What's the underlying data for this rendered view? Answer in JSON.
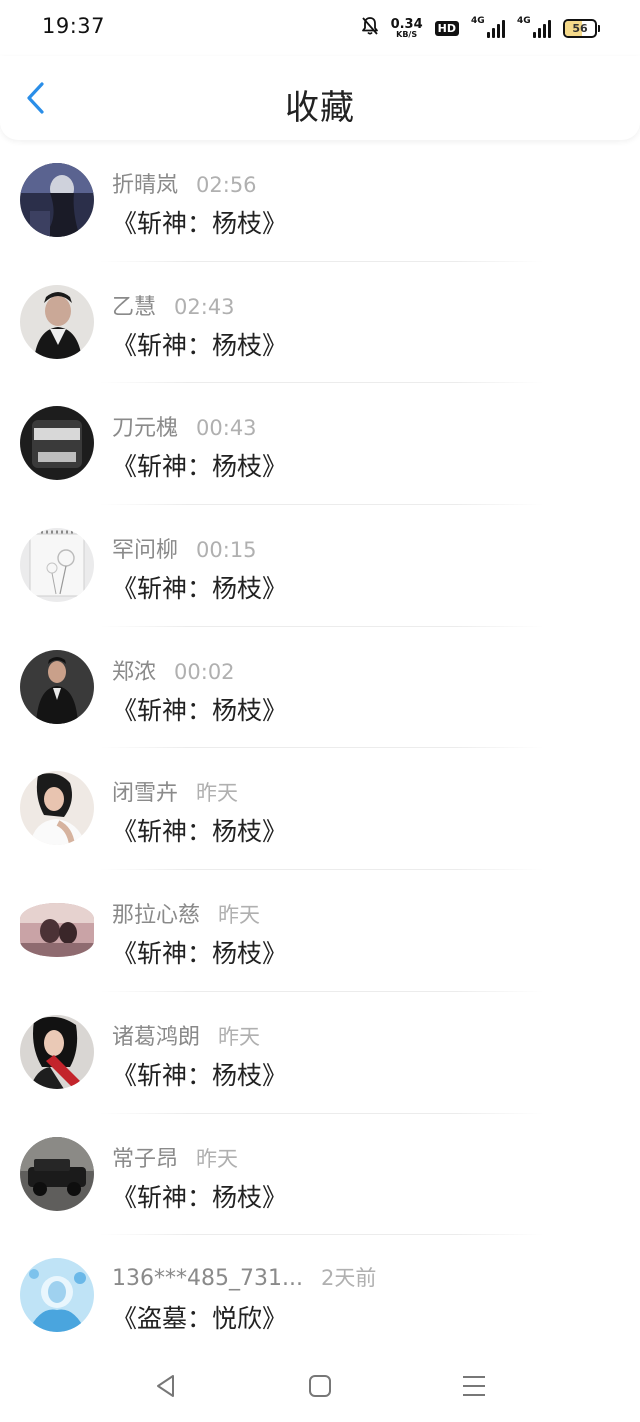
{
  "status_bar": {
    "time": "19:37",
    "net_speed_value": "0.34",
    "net_speed_unit": "KB/S",
    "hd_label": "HD",
    "signal_1_label": "4G",
    "signal_2_label": "4G",
    "battery_level": "56",
    "icons": [
      "bell-muted-icon",
      "hd-icon",
      "signal-4g-icon",
      "signal-4g-icon",
      "battery-icon"
    ]
  },
  "header": {
    "title": "收藏",
    "back_icon": "chevron-left-icon",
    "accent_color": "#2a8ee8"
  },
  "favorites": [
    {
      "user": "折晴岚",
      "time": "02:56",
      "title": "《斩神：杨枝》"
    },
    {
      "user": "乙慧",
      "time": "02:43",
      "title": "《斩神：杨枝》"
    },
    {
      "user": "刀元槐",
      "time": "00:43",
      "title": "《斩神：杨枝》"
    },
    {
      "user": "罕问柳",
      "time": "00:15",
      "title": "《斩神：杨枝》"
    },
    {
      "user": "郑浓",
      "time": "00:02",
      "title": "《斩神：杨枝》"
    },
    {
      "user": "闭雪卉",
      "time": "昨天",
      "title": "《斩神：杨枝》"
    },
    {
      "user": "那拉心慈",
      "time": "昨天",
      "title": "《斩神：杨枝》"
    },
    {
      "user": "诸葛鸿朗",
      "time": "昨天",
      "title": "《斩神：杨枝》"
    },
    {
      "user": "常子昂",
      "time": "昨天",
      "title": "《斩神：杨枝》"
    },
    {
      "user": "136***485_731...",
      "time": "2天前",
      "title": "《盗墓：悦欣》"
    }
  ],
  "nav_bar": {
    "icons": [
      "back-triangle-icon",
      "home-square-icon",
      "menu-lines-icon"
    ]
  }
}
